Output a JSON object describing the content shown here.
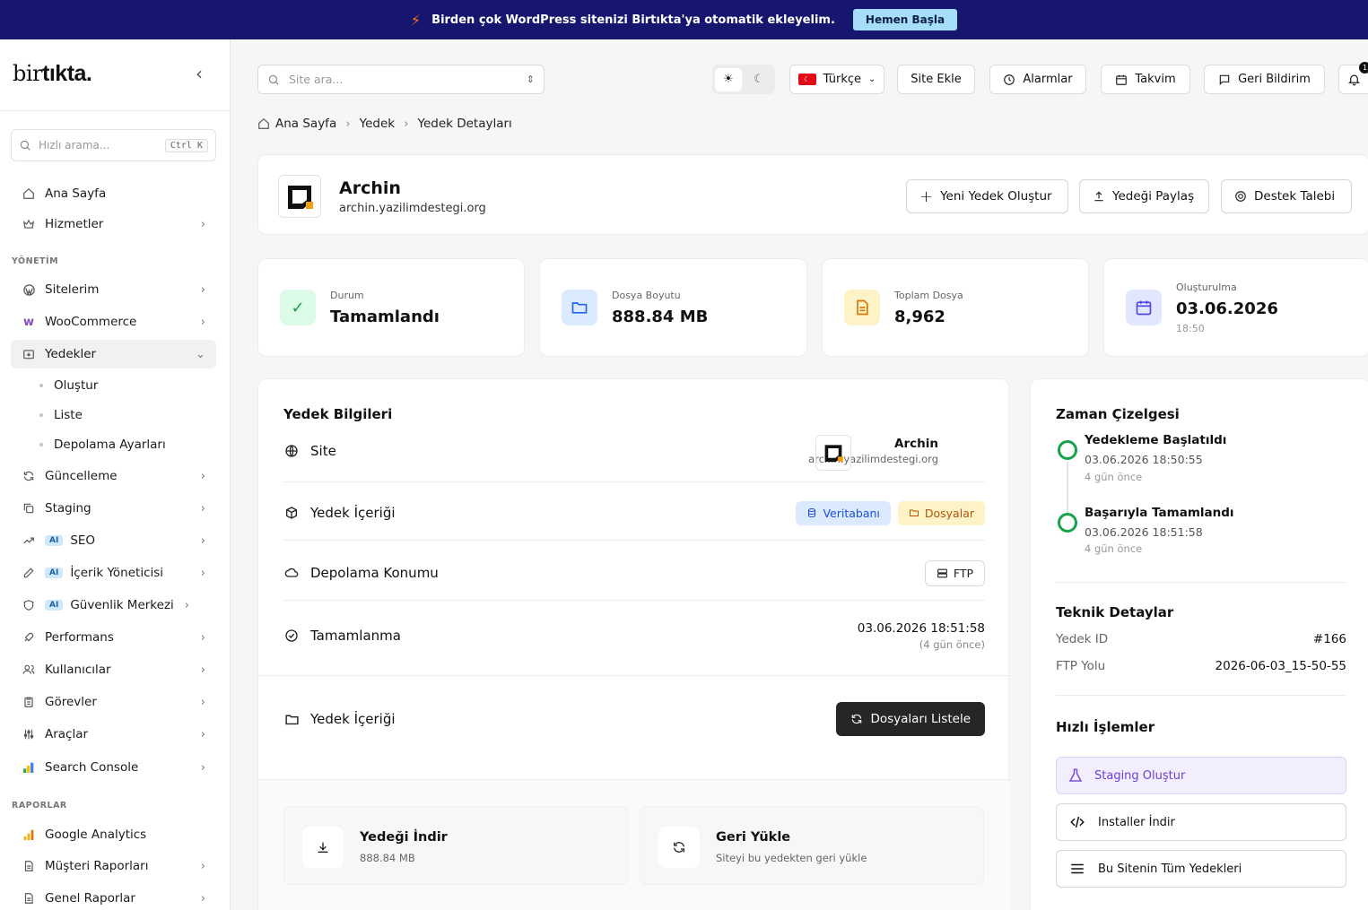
{
  "banner": {
    "text": "Birden çok WordPress sitenizi Birtıkta'ya otomatik ekleyelim.",
    "cta": "Hemen Başla"
  },
  "sidebar": {
    "logo_part1": "bir",
    "logo_part2": "tıkta.",
    "quick_search_placeholder": "Hızlı arama...",
    "quick_search_kbd": "Ctrl K",
    "items_top": [
      {
        "label": "Ana Sayfa"
      },
      {
        "label": "Hizmetler"
      }
    ],
    "section_management": "YÖNETİM",
    "items_management": [
      {
        "label": "Sitelerim"
      },
      {
        "label": "WooCommerce"
      },
      {
        "label": "Yedekler"
      }
    ],
    "backup_subitems": [
      {
        "label": "Oluştur"
      },
      {
        "label": "Liste"
      },
      {
        "label": "Depolama Ayarları"
      }
    ],
    "items_management2": [
      {
        "label": "Güncelleme"
      },
      {
        "label": "Staging"
      },
      {
        "label": "SEO",
        "badge": "AI"
      },
      {
        "label": "İçerik Yöneticisi",
        "badge": "AI"
      },
      {
        "label": "Güvenlik Merkezi",
        "badge": "AI"
      },
      {
        "label": "Performans"
      },
      {
        "label": "Kullanıcılar"
      },
      {
        "label": "Görevler"
      },
      {
        "label": "Araçlar"
      },
      {
        "label": "Search Console"
      }
    ],
    "section_reports": "RAPORLAR",
    "items_reports": [
      {
        "label": "Google Analytics"
      },
      {
        "label": "Müşteri Raporları"
      },
      {
        "label": "Genel Raporlar"
      }
    ]
  },
  "topbar": {
    "search_placeholder": "Site ara...",
    "language": "Türkçe",
    "add_site": "Site Ekle",
    "alarms": "Alarmlar",
    "calendar": "Takvim",
    "feedback": "Geri Bildirim",
    "notification_count": "1"
  },
  "breadcrumb": [
    "Ana Sayfa",
    "Yedek",
    "Yedek Detayları"
  ],
  "site": {
    "name": "Archin",
    "url": "archin.yazilimdestegi.org",
    "btn_new_backup": "Yeni Yedek Oluştur",
    "btn_share": "Yedeği Paylaş",
    "btn_support": "Destek Talebi"
  },
  "stats": [
    {
      "label": "Durum",
      "value": "Tamamlandı",
      "color": "#16a34a"
    },
    {
      "label": "Dosya Boyutu",
      "value": "888.84 MB",
      "color": "#2563eb"
    },
    {
      "label": "Toplam Dosya",
      "value": "8,962",
      "color": "#d97706"
    },
    {
      "label": "Oluşturulma",
      "value": "03.06.2026",
      "sub": "18:50",
      "color": "#4f46e5"
    }
  ],
  "backup_info": {
    "title": "Yedek Bilgileri",
    "site_label": "Site",
    "site_name": "Archin",
    "site_url": "archin.yazilimdestegi.org",
    "content_label": "Yedek İçeriği",
    "tag_db": "Veritabanı",
    "tag_files": "Dosyalar",
    "storage_label": "Depolama Konumu",
    "storage_value": "FTP",
    "completion_label": "Tamamlanma",
    "completion_value": "03.06.2026 18:51:58",
    "completion_ago": "(4 gün önce)",
    "content_section_title": "Yedek İçeriği",
    "list_files_btn": "Dosyaları Listele"
  },
  "actions": {
    "download_title": "Yedeği İndir",
    "download_sub": "888.84 MB",
    "restore_title": "Geri Yükle",
    "restore_sub": "Siteyi bu yedekten geri yükle"
  },
  "timeline": {
    "title": "Zaman Çizelgesi",
    "events": [
      {
        "title": "Yedekleme Başlatıldı",
        "time": "03.06.2026 18:50:55",
        "ago": "4 gün önce"
      },
      {
        "title": "Başarıyla Tamamlandı",
        "time": "03.06.2026 18:51:58",
        "ago": "4 gün önce"
      }
    ]
  },
  "technical": {
    "title": "Teknik Detaylar",
    "id_label": "Yedek ID",
    "id_value": "#166",
    "ftp_label": "FTP Yolu",
    "ftp_value": "2026-06-03_15-50-55"
  },
  "quick_actions": {
    "title": "Hızlı İşlemler",
    "staging": "Staging Oluştur",
    "installer": "Installer İndir",
    "all_backups": "Bu Sitenin Tüm Yedekleri"
  }
}
